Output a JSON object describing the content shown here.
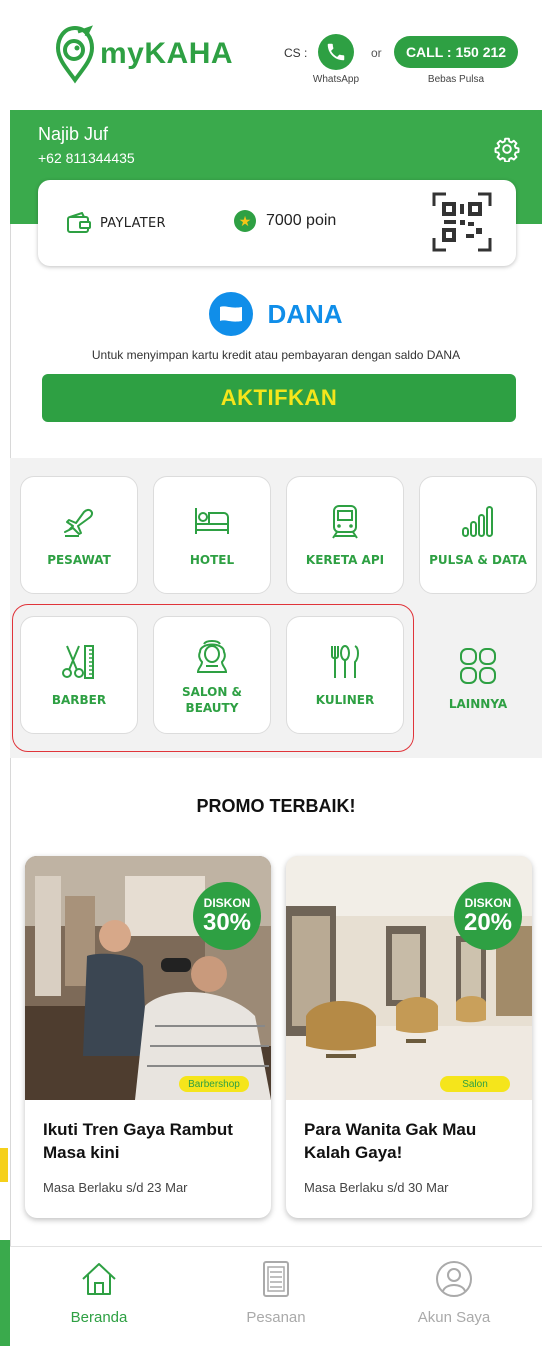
{
  "header": {
    "brand": "myKAHA",
    "cs_label": "CS :",
    "whatsapp_label": "WhatsApp",
    "or_label": "or",
    "call_label": "CALL : 150 212",
    "call_sub": "Bebas Pulsa"
  },
  "profile": {
    "name": "Najib Juf",
    "phone": "+62 811344435"
  },
  "wallet": {
    "paylater_label": "PAYLATER",
    "points_label": "7000 poin"
  },
  "dana": {
    "title": "DANA",
    "description": "Untuk menyimpan kartu kredit atau pembayaran dengan saldo DANA",
    "button_label": "AKTIFKAN"
  },
  "services": [
    {
      "label": "PESAWAT",
      "icon": "plane-icon"
    },
    {
      "label": "HOTEL",
      "icon": "bed-icon"
    },
    {
      "label": "KERETA API",
      "icon": "train-icon"
    },
    {
      "label": "PULSA & DATA",
      "icon": "signal-icon"
    },
    {
      "label": "BARBER",
      "icon": "scissors-comb-icon"
    },
    {
      "label": "SALON & BEAUTY",
      "icon": "salon-woman-icon"
    },
    {
      "label": "KULINER",
      "icon": "cutlery-icon"
    },
    {
      "label": "LAINNYA",
      "icon": "grid-four-icon"
    }
  ],
  "promo": {
    "title": "PROMO TERBAIK!",
    "cards": [
      {
        "discount_label": "DISKON",
        "discount_value": "30%",
        "tag": "Barbershop",
        "headline": "Ikuti Tren Gaya Rambut Masa kini",
        "validity": "Masa Berlaku s/d 23 Mar"
      },
      {
        "discount_label": "DISKON",
        "discount_value": "20%",
        "tag": "Salon",
        "headline": "Para Wanita Gak Mau Kalah Gaya!",
        "validity": "Masa Berlaku s/d 30 Mar"
      }
    ]
  },
  "nav": {
    "items": [
      {
        "label": "Beranda",
        "icon": "home-icon",
        "active": true
      },
      {
        "label": "Pesanan",
        "icon": "orders-icon",
        "active": false
      },
      {
        "label": "Akun Saya",
        "icon": "account-icon",
        "active": false
      }
    ]
  },
  "colors": {
    "brand_green": "#2ea043",
    "band_green": "#3aaa4c",
    "accent_yellow": "#f5e51b",
    "dana_blue": "#108ee9",
    "highlight_red": "#e0343a"
  }
}
